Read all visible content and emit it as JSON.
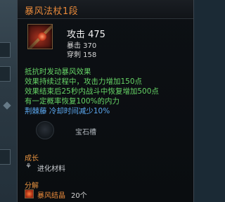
{
  "tooltip": {
    "item_name": "暴风法杖1段",
    "main_stat": "攻击 475",
    "sub_stats": [
      "暴击 370",
      "穿刺 158"
    ],
    "effect_header": "抵抗时发动暴风效果",
    "effects": [
      "效果持续过程中，攻击力增加150点",
      "效果结束后25秒内战斗中恢复增加500点",
      "有一定概率恢复100%的内力"
    ],
    "skill_bonus": "荆棘藤 冷却时间减少10%",
    "gem_slot_label": "宝石槽",
    "growth_header": "成长",
    "growth_item": "进化材料",
    "decompose_header": "分解",
    "decompose_item_name": "暴风结晶",
    "decompose_item_count": "20个"
  },
  "colors": {
    "title": "#e8893a",
    "effect_green": "#66d466",
    "skill_blue": "#5ba8f0",
    "section_orange": "#e89340"
  },
  "icons": {
    "item": "red-staff-icon",
    "gem": "empty-gem-slot-icon",
    "growth": "evolve-icon",
    "decompose": "crystal-icon"
  }
}
